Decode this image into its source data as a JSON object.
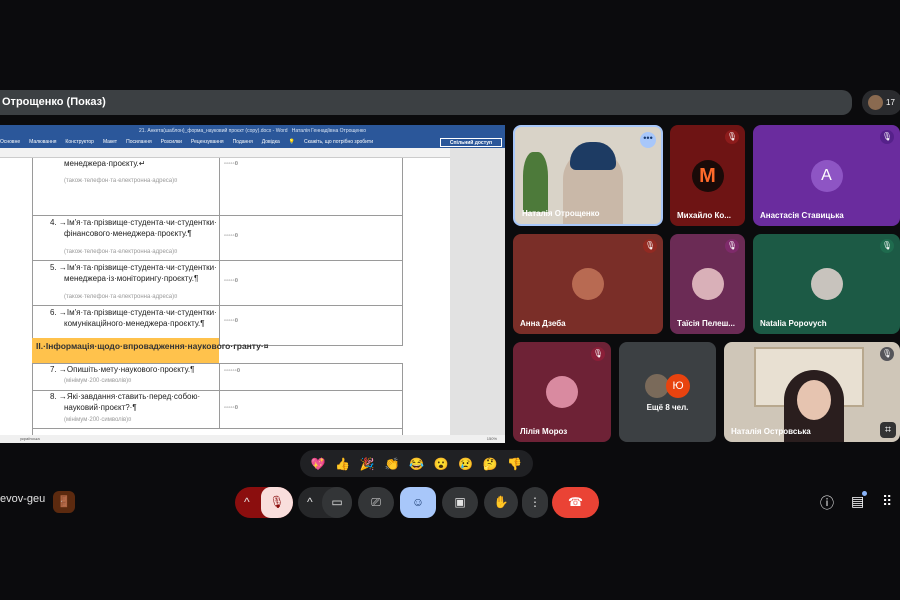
{
  "top_bar": {
    "title": "Отрощенко (Показ)",
    "participant_count": "17"
  },
  "word": {
    "title": "21. Анкета(шаблон)_форма_науковий проєкт (copy).docx - Word",
    "user": "Наталія Геннадіївна Отрощенко",
    "menu": [
      "Основне",
      "Малювання",
      "Конструктор",
      "Макет",
      "Посилання",
      "Розсилки",
      "Рецензування",
      "Подання",
      "Довідка"
    ],
    "tell_me": "Скажіть, що потрібно зробити",
    "share": "Спільний доступ",
    "status_lang": "українська",
    "zoom": "150%"
  },
  "doc": {
    "row3": {
      "line": "менеджера·проєкту.↵",
      "note": "(також·телефон·та·електронна·адреса)¤",
      "value": "◦◦◦◦◦¤"
    },
    "row4": {
      "l1": "4. →Ім'я·та·прізвище·студента·чи·студентки·",
      "l2": "фінансового·менеджера·проєкту.¶",
      "note": "(також·телефон·та·електронна·адреса)¤",
      "value": "◦◦◦◦◦¤"
    },
    "row5": {
      "l1": "5. →Ім'я·та·прізвище·студента·чи·студентки·",
      "l2": "менеджера·із·моніторингу·проєкту.¶",
      "note": "(також·телефон·та·електронна·адреса)¤",
      "value": "◦◦◦◦◦¤"
    },
    "row6": {
      "l1": "6. →Ім'я·та·прізвище·студента·чи·студентки·",
      "l2": "комунікаційного·менеджера·проєкту.¶",
      "value": "◦◦◦◦◦¤"
    },
    "pilcrow": "¶",
    "section": "ІІ.·Інформація·щодо·впровадження·наукового·гранту·¤",
    "row7": {
      "l1": "7. →Опишіть·мету·наукового·проєкту.¶",
      "note": "(мінімум·200·символів)¤",
      "value": "◦◦◦◦◦◦¤"
    },
    "row8": {
      "l1": "8. →Які·завдання·ставить·перед·собою·",
      "l2": "науковий·проєкт?·¶",
      "note": "(мінімум·200·символів)¤",
      "value": "◦◦◦◦◦¤"
    }
  },
  "tiles": [
    {
      "name": "Наталія Отрощенко",
      "color": "#d9d3c8"
    },
    {
      "name": "Михайло Ко...",
      "color": "#6e1414",
      "initial": "M"
    },
    {
      "name": "Анастасія Ставицька",
      "color": "#6a2c9e",
      "initial": "A"
    },
    {
      "name": "Анна Дзеба",
      "color": "#7a2e28"
    },
    {
      "name": "Таїсія Пелеш...",
      "color": "#6b2b55"
    },
    {
      "name": "Natalia Popovych",
      "color": "#1c5a45"
    },
    {
      "name": "Лілія Мороз",
      "color": "#6e2236"
    },
    {
      "name": "Ещё 8 чел.",
      "color": "#3c4043",
      "initial": "Ю"
    },
    {
      "name": "Наталія Островська",
      "color": "#cfc6b8"
    }
  ],
  "reactions": [
    "💖",
    "👍",
    "🎉",
    "👏",
    "😂",
    "😮",
    "😢",
    "🤔",
    "👎"
  ],
  "bottom": {
    "meeting_code": "evov-geu"
  },
  "colors": {
    "end_call": "#ea4335",
    "emoji_active": "#a8c7fa",
    "mic_off": "#f9dedc",
    "word_blue": "#2b579a",
    "section_header": "#ffc24c"
  }
}
